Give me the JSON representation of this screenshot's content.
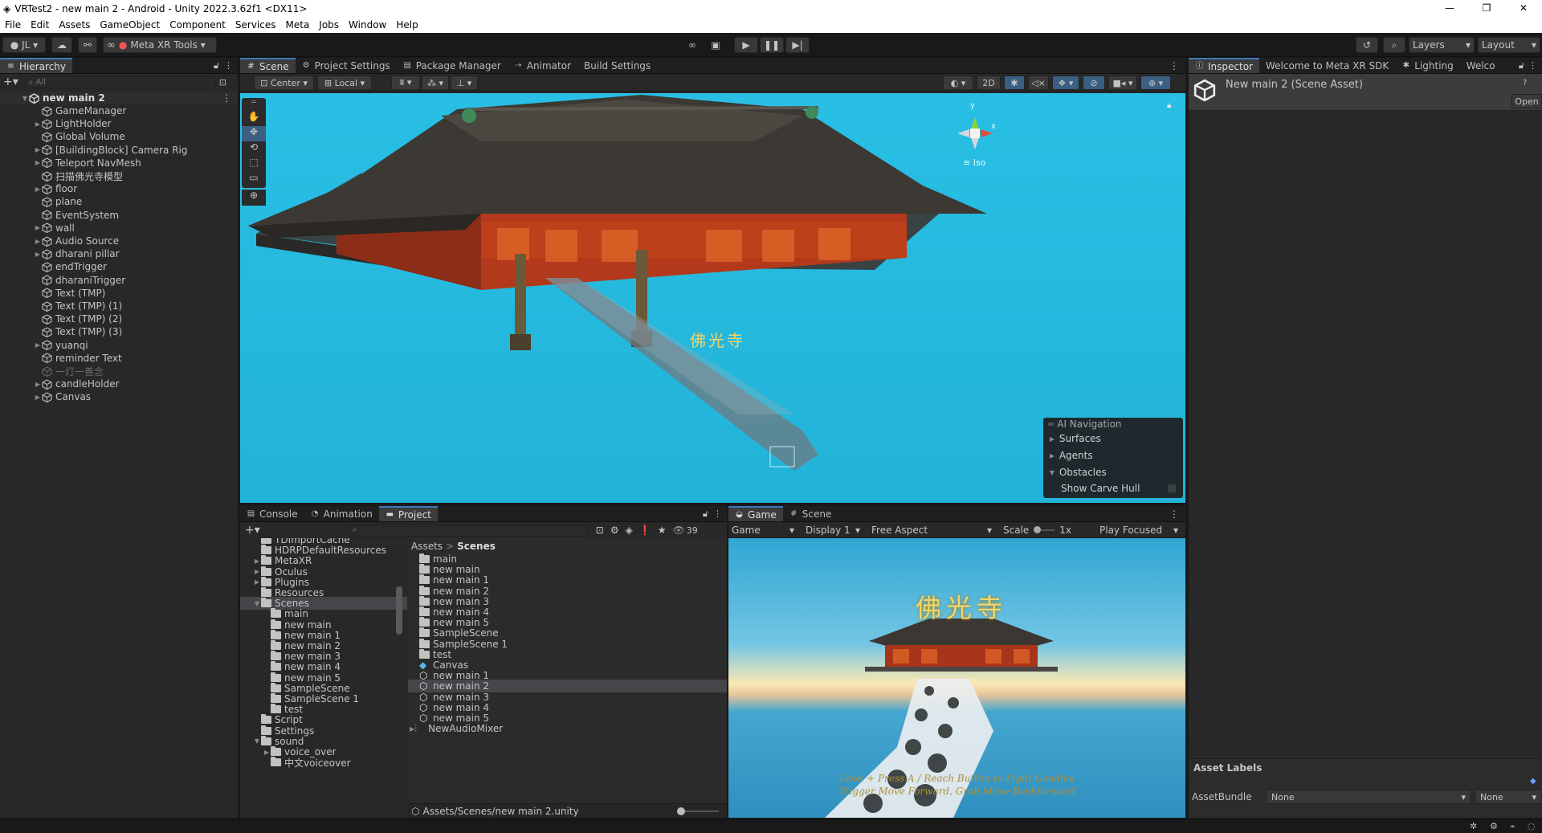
{
  "window": {
    "title": "VRTest2 - new main 2 - Android - Unity 2022.3.62f1 <DX11>",
    "minimize": "—",
    "maximize": "❐",
    "close": "✕"
  },
  "menu": [
    "File",
    "Edit",
    "Assets",
    "GameObject",
    "Component",
    "Services",
    "Meta",
    "Jobs",
    "Window",
    "Help"
  ],
  "toolbar": {
    "account": "JL",
    "meta_tools": "Meta XR Tools",
    "layers": "Layers",
    "layout": "Layout"
  },
  "tabs_top": {
    "scene": "Scene",
    "project_settings": "Project Settings",
    "package_manager": "Package Manager",
    "animator": "Animator",
    "build_settings": "Build Settings"
  },
  "scene_toolbar": {
    "pivot": "Center",
    "space": "Local",
    "mode2d": "2D"
  },
  "gizmo": {
    "y": "y",
    "x": "x",
    "iso": "Iso"
  },
  "overlay": {
    "title": "AI Navigation",
    "items": [
      "Surfaces",
      "Agents",
      "Obstacles"
    ],
    "show_carve": "Show Carve Hull"
  },
  "scene_sign": "佛光寺",
  "hierarchy": {
    "tab": "Hierarchy",
    "search_placeholder": "All",
    "root": "new main 2",
    "items": [
      {
        "label": "GameManager",
        "arrow": ""
      },
      {
        "label": "LightHolder",
        "arrow": "▶"
      },
      {
        "label": "Global Volume",
        "arrow": ""
      },
      {
        "label": "[BuildingBlock] Camera Rig",
        "arrow": "▶"
      },
      {
        "label": "Teleport NavMesh",
        "arrow": "▶"
      },
      {
        "label": "扫描佛光寺模型",
        "arrow": ""
      },
      {
        "label": "floor",
        "arrow": "▶"
      },
      {
        "label": "plane",
        "arrow": ""
      },
      {
        "label": "EventSystem",
        "arrow": ""
      },
      {
        "label": "wall",
        "arrow": "▶"
      },
      {
        "label": "Audio Source",
        "arrow": "▶"
      },
      {
        "label": "dharani pillar",
        "arrow": "▶"
      },
      {
        "label": "endTrigger",
        "arrow": ""
      },
      {
        "label": "dharaniTrigger",
        "arrow": ""
      },
      {
        "label": "Text (TMP)",
        "arrow": ""
      },
      {
        "label": "Text (TMP) (1)",
        "arrow": ""
      },
      {
        "label": "Text (TMP) (2)",
        "arrow": ""
      },
      {
        "label": "Text (TMP) (3)",
        "arrow": ""
      },
      {
        "label": "yuanqi",
        "arrow": "▶"
      },
      {
        "label": "reminder Text",
        "arrow": ""
      },
      {
        "label": "一灯一善念",
        "arrow": "",
        "disabled": true
      },
      {
        "label": "candleHolder",
        "arrow": "▶"
      },
      {
        "label": "Canvas",
        "arrow": "▶"
      }
    ]
  },
  "inspector": {
    "tabs": [
      "Inspector",
      "Welcome to Meta XR SDK",
      "Lighting",
      "Welco"
    ],
    "title": "New main 2 (Scene Asset)",
    "open": "Open",
    "asset_labels": "Asset Labels",
    "asset_bundle": "AssetBundle",
    "bundle_value": "None",
    "variant_value": "None"
  },
  "bottom_tabs": {
    "console": "Console",
    "animation": "Animation",
    "project": "Project",
    "hidden_count": "39"
  },
  "project_tree": [
    {
      "label": "TDImportCache",
      "indent": 0,
      "arrow": ""
    },
    {
      "label": "HDRPDefaultResources",
      "indent": 0,
      "arrow": ""
    },
    {
      "label": "MetaXR",
      "indent": 0,
      "arrow": "▶"
    },
    {
      "label": "Oculus",
      "indent": 0,
      "arrow": "▶"
    },
    {
      "label": "Plugins",
      "indent": 0,
      "arrow": "▶"
    },
    {
      "label": "Resources",
      "indent": 0,
      "arrow": ""
    },
    {
      "label": "Scenes",
      "indent": 0,
      "arrow": "▼",
      "selected": true
    },
    {
      "label": "main",
      "indent": 1,
      "arrow": ""
    },
    {
      "label": "new main",
      "indent": 1,
      "arrow": ""
    },
    {
      "label": "new main 1",
      "indent": 1,
      "arrow": ""
    },
    {
      "label": "new main 2",
      "indent": 1,
      "arrow": ""
    },
    {
      "label": "new main 3",
      "indent": 1,
      "arrow": ""
    },
    {
      "label": "new main 4",
      "indent": 1,
      "arrow": ""
    },
    {
      "label": "new main 5",
      "indent": 1,
      "arrow": ""
    },
    {
      "label": "SampleScene",
      "indent": 1,
      "arrow": ""
    },
    {
      "label": "SampleScene 1",
      "indent": 1,
      "arrow": ""
    },
    {
      "label": "test",
      "indent": 1,
      "arrow": ""
    },
    {
      "label": "Script",
      "indent": 0,
      "arrow": ""
    },
    {
      "label": "Settings",
      "indent": 0,
      "arrow": ""
    },
    {
      "label": "sound",
      "indent": 0,
      "arrow": "▼"
    },
    {
      "label": "voice_over",
      "indent": 1,
      "arrow": "▶"
    },
    {
      "label": "中文voiceover",
      "indent": 1,
      "arrow": ""
    }
  ],
  "breadcrumb": [
    "Assets",
    "Scenes"
  ],
  "project_files": [
    {
      "label": "main",
      "type": "folder"
    },
    {
      "label": "new main",
      "type": "folder"
    },
    {
      "label": "new main 1",
      "type": "folder"
    },
    {
      "label": "new main 2",
      "type": "folder"
    },
    {
      "label": "new main 3",
      "type": "folder"
    },
    {
      "label": "new main 4",
      "type": "folder"
    },
    {
      "label": "new main 5",
      "type": "folder"
    },
    {
      "label": "SampleScene",
      "type": "folder"
    },
    {
      "label": "SampleScene 1",
      "type": "folder"
    },
    {
      "label": "test",
      "type": "folder"
    },
    {
      "label": "Canvas",
      "type": "prefab"
    },
    {
      "label": "new main 1",
      "type": "scene"
    },
    {
      "label": "new main 2",
      "type": "scene",
      "selected": true
    },
    {
      "label": "new main 3",
      "type": "scene"
    },
    {
      "label": "new main 4",
      "type": "scene"
    },
    {
      "label": "new main 5",
      "type": "scene"
    },
    {
      "label": "NewAudioMixer",
      "type": "mixer"
    }
  ],
  "project_path": "Assets/Scenes/new main 2.unity",
  "game": {
    "tabs": [
      "Game",
      "Scene"
    ],
    "mode": "Game",
    "display": "Display 1",
    "aspect": "Free Aspect",
    "scale_label": "Scale",
    "scale_value": "1x",
    "focus": "Play Focused",
    "sign": "佛光寺",
    "hint1": "Look + Press A / Reach Button to Light Candles",
    "hint2": "Trigger Move Forward, Grab Move Backforward"
  },
  "colors": {
    "accent": "#3a79bb",
    "selection": "#2c5d87",
    "sky": "#26b8dd",
    "sign": "#f3d66b"
  }
}
